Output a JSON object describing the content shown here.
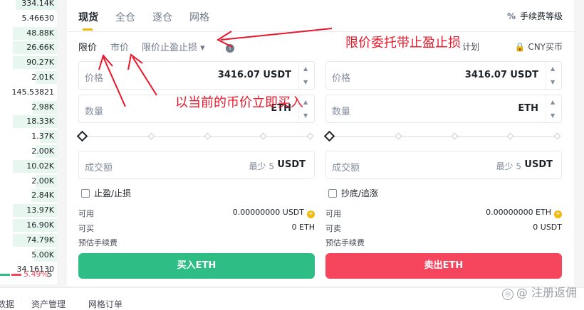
{
  "order_book": {
    "values": [
      "334.14K",
      "5.46630",
      "48.88K",
      "26.66K",
      "90.27K",
      "2.01K",
      "145.53821",
      "2.98K",
      "18.33K",
      "1.37K",
      "2.00K",
      "10.02K",
      "2.00K",
      "2.84K",
      "13.97K",
      "16.90K",
      "74.79K",
      "5.00K",
      "34.16130"
    ],
    "ratio_pct": "5.49%",
    "ratio_suffix": "S"
  },
  "tabs": [
    "现货",
    "全仓",
    "逐仓",
    "网格"
  ],
  "fee_label": "手续费等级",
  "order_types": {
    "limit": "限价",
    "market": "市价",
    "tp_sl": "限价止盈止损"
  },
  "plan_label": "计划",
  "cny_buy_label": "CNY买币",
  "buy": {
    "price_label": "价格",
    "price_value": "3416.07",
    "price_unit": "USDT",
    "qty_label": "数量",
    "qty_unit": "ETH",
    "amount_label": "成交额",
    "amount_min": "最少 5",
    "amount_unit": "USDT",
    "check_label": "止盈/止损",
    "avail_label": "可用",
    "avail_value": "0.00000000 USDT",
    "can_label": "可买",
    "can_value": "0 ETH",
    "fee_est_label": "预估手续费",
    "button_label": "买入ETH"
  },
  "sell": {
    "price_label": "价格",
    "price_value": "3416.07",
    "price_unit": "USDT",
    "qty_label": "数量",
    "qty_unit": "ETH",
    "amount_label": "成交额",
    "amount_min": "最少 5",
    "amount_unit": "USDT",
    "check_label": "抄底/追涨",
    "avail_label": "可用",
    "avail_value": "0.00000000 ETH",
    "can_label": "可卖",
    "can_value": "0 USDT",
    "fee_est_label": "预估手续费",
    "button_label": "卖出ETH"
  },
  "bottom_tabs": [
    "数据",
    "资产管理",
    "网格订单"
  ],
  "annotations": {
    "limit_tp_sl": "限价委托带止盈止损",
    "market_now": "以当前的币价立即买入"
  },
  "watermark": "注册返佣",
  "colors": {
    "buy": "#2ebd85",
    "sell": "#f6465d",
    "accent": "#f0b90b",
    "annotation": "#e8172a"
  }
}
